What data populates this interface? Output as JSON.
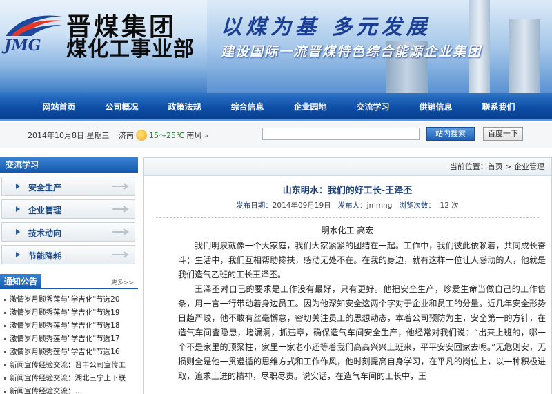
{
  "banner": {
    "logo_en": "JMG",
    "logo_cn_line1": "晋煤集团",
    "logo_cn_line2": "煤化工事业部",
    "slogan_line1": "以煤为基  多元发展",
    "slogan_line2": "建设国际一流晋煤特色综合能源企业集团"
  },
  "nav": {
    "items": [
      "网站首页",
      "公司概况",
      "政策法规",
      "综合信息",
      "企业园地",
      "交流学习",
      "供销信息",
      "联系我们"
    ]
  },
  "infobar": {
    "date": "2014年10月8日  星期三",
    "city": "济南",
    "temp": "15～25℃",
    "wind": "南风 »",
    "search_placeholder": "",
    "site_search_label": "站内搜索",
    "baidu_label": "百度一下"
  },
  "sidebar": {
    "section_title": "交流学习",
    "items": [
      "安全生产",
      "企业管理",
      "技术动向",
      "节能降耗"
    ],
    "notice_title": "通知公告",
    "notice_more": "更多>>",
    "notices": [
      "激情岁月顾秀莲与\"学吉化\"节选20",
      "激情岁月顾秀莲与\"学吉化\"节选19",
      "激情岁月顾秀莲与\"学吉化\"节选18",
      "激情岁月顾秀莲与\"学吉化\"节选17",
      "激情岁月顾秀莲与\"学吉化\"节选16",
      "新闻宣传经验交流：晋丰公司宣传工",
      "新闻宣传经验交流：湖北三宁上下联",
      "新闻宣传经验交流：…"
    ]
  },
  "main": {
    "breadcrumb": "当前位置：首页 > 企业管理",
    "title": "山东明水：我们的好工长-王泽丕",
    "meta_date_label": "发布日期：",
    "meta_date": "2014年09月19日",
    "meta_publisher_label": "发布人：",
    "meta_publisher": "jmmhg",
    "meta_views_label": "浏览次数：",
    "meta_views": "12  次",
    "author": "明水化工    高宏",
    "paragraphs": [
      "我们明泉就像一个大家庭，我们大家紧紧的团结在一起。工作中，我们彼此依赖着，共同成长奋斗；生活中，我们互相帮助搀扶，感动无处不在。在我的身边，就有这样一位让人感动的人，他就是我们造气乙班的工长王泽丕。",
      "王泽丕对自己的要求是工作没有最好，只有更好。他把安全生产，珍爱生命当做自己的工作信条，用一言一行带动着身边员工。因为他深知安全这两个字对于企业和员工的分量。近几年安全形势日趋严峻，他不敢有丝毫懈怠，密切关注员工的思想动态，本着公司预防为主，安全第一的方针，在造气车间查隐患，堵漏洞，抓违章，确保造气车间安全生产，他经常对我们说：“出来上班的，哪一个不是家里的顶梁柱，家里一家老小还等着我们高高兴兴上班来，平平安安回家去呢。”无危则安，无损则全是他一贯遵循的思维方式和工作作风，他时刻提高自身学习，在平凡的岗位上，以一种积极进取，追求上进的精神，尽职尽责。说实话，在造气车间的工长中，王"
    ]
  }
}
